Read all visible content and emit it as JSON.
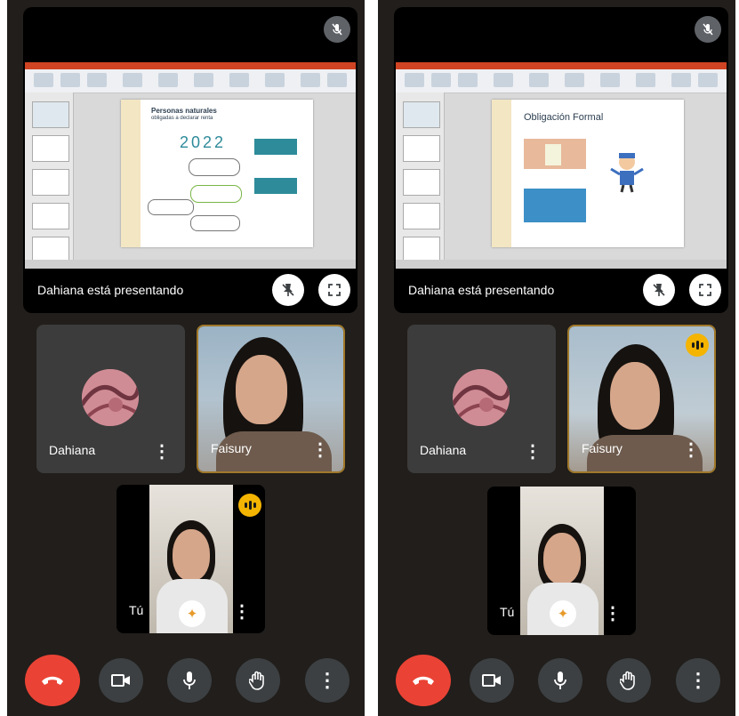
{
  "phones": [
    {
      "presenting_label": "Dahiana está presentando",
      "slide": {
        "title_line1": "Personas naturales",
        "title_line2": "obligadas a declarar renta",
        "year": "2022"
      },
      "participants": [
        {
          "name": "Dahiana",
          "menu": "⋮"
        },
        {
          "name": "Faisury",
          "menu": "⋮"
        },
        {
          "name": "Tú",
          "menu": "⋮"
        }
      ],
      "speaking": "Tú"
    },
    {
      "presenting_label": "Dahiana está presentando",
      "slide": {
        "title": "Obligación Formal"
      },
      "participants": [
        {
          "name": "Dahiana",
          "menu": "⋮"
        },
        {
          "name": "Faisury",
          "menu": "⋮"
        },
        {
          "name": "Tú",
          "menu": "⋮"
        }
      ],
      "speaking": "Faisury"
    }
  ],
  "controls": {
    "end_call": "end-call",
    "camera": "camera",
    "mic": "microphone",
    "hand": "raise-hand",
    "more": "⋮"
  },
  "colors": {
    "background": "#211e1b",
    "end_call": "#ea4335",
    "control": "#3c4043",
    "speaking": "#f4b400",
    "slide_teal": "#2e8b9a"
  }
}
